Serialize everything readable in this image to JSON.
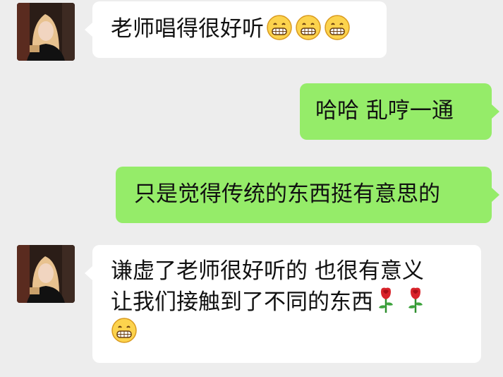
{
  "messages": [
    {
      "sender": "other",
      "avatar_icon": "user-avatar-photo",
      "text": "老师唱得很好听",
      "emoji_icon": "grinning-face-emoji",
      "emoji_count": 3
    },
    {
      "sender": "self",
      "text": "哈哈 乱哼一通"
    },
    {
      "sender": "self",
      "text": "只是觉得传统的东西挺有意思的"
    },
    {
      "sender": "other",
      "avatar_icon": "user-avatar-photo",
      "lines": [
        "谦虚了老师很好听的 也很有意义",
        "让我们接触到了不同的东西"
      ],
      "emoji_icons": [
        "rose-emoji",
        "grinning-face-emoji"
      ]
    }
  ],
  "colors": {
    "background": "#ededed",
    "received_bubble": "#ffffff",
    "sent_bubble": "#95ec69",
    "text": "#111111"
  }
}
